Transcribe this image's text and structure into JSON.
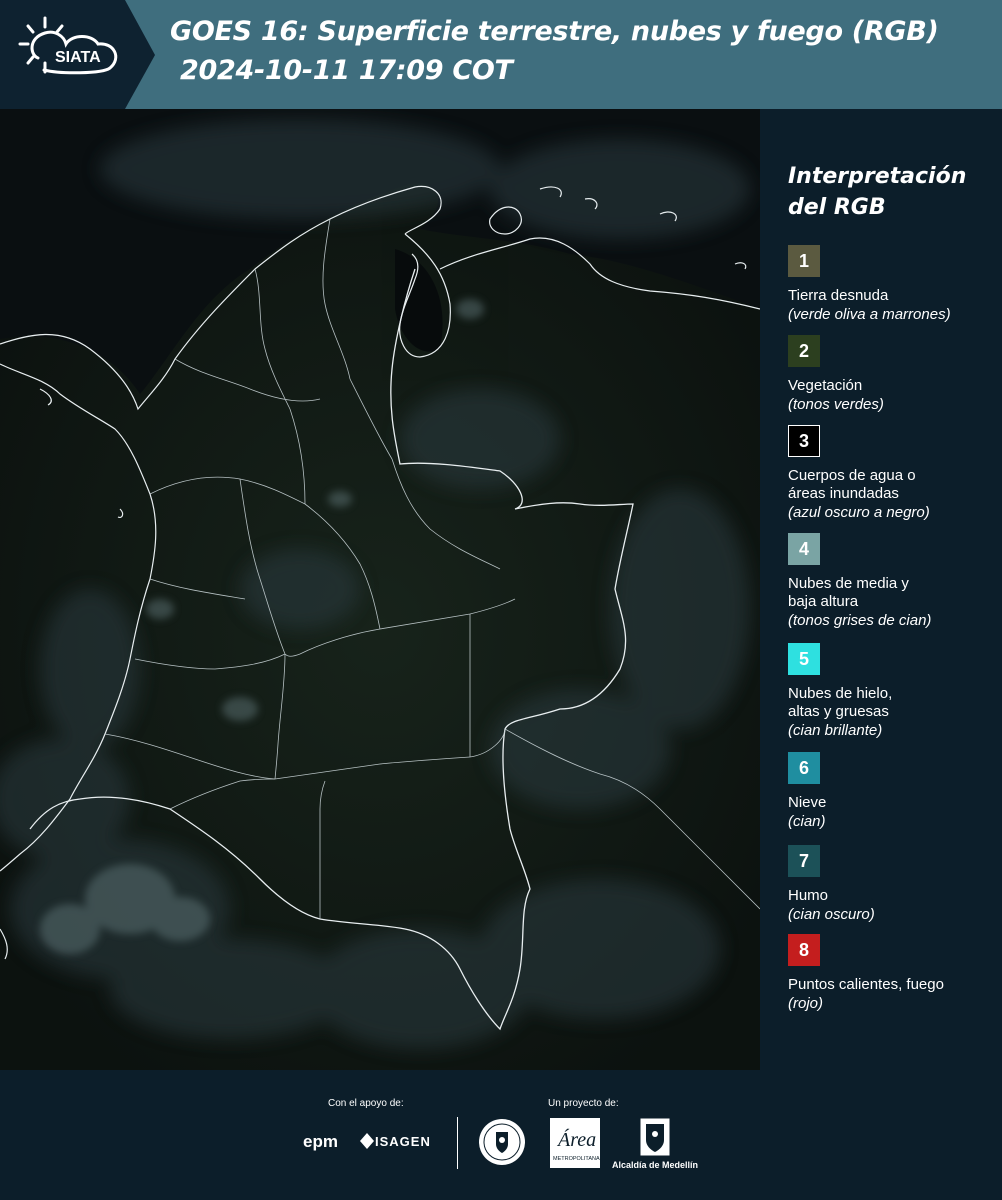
{
  "header": {
    "logo_text": "SIATA",
    "title_line1": "GOES 16: Superficie terrestre, nubes y fuego (RGB)",
    "title_line2": "2024-10-11 17:09 COT"
  },
  "map": {
    "icon": "satellite-map-colombia"
  },
  "legend": {
    "title": "Interpretación del RGB",
    "items": [
      {
        "num": "1",
        "label": "Tierra desnuda",
        "desc": "(verde oliva a marrones)",
        "color": "#5b5a40"
      },
      {
        "num": "2",
        "label": "Vegetación",
        "desc": "(tonos verdes)",
        "color": "#2c3f1f"
      },
      {
        "num": "3",
        "label": "Cuerpos de agua o áreas inundadas",
        "desc": "(azul oscuro a negro)",
        "color": "#000000"
      },
      {
        "num": "4",
        "label": "Nubes de media y baja altura",
        "desc": "(tonos grises de cian)",
        "color": "#7aa4a4"
      },
      {
        "num": "5",
        "label": "Nubes de hielo, altas y gruesas",
        "desc": "(cian brillante)",
        "color": "#2ee0e0"
      },
      {
        "num": "6",
        "label": "Nieve",
        "desc": "(cian)",
        "color": "#1f8ea0"
      },
      {
        "num": "7",
        "label": "Humo",
        "desc": "(cian oscuro)",
        "color": "#1c5158"
      },
      {
        "num": "8",
        "label": "Puntos calientes, fuego",
        "desc": "(rojo)",
        "color": "#c41e1e"
      }
    ]
  },
  "footer": {
    "support_label": "Con el apoyo de:",
    "project_label": "Un proyecto de:",
    "epm": "epm",
    "isagen": "ISAGEN",
    "alcaldia": "Alcaldía de Medellín",
    "metropolitana": "METROPOLITANA"
  }
}
